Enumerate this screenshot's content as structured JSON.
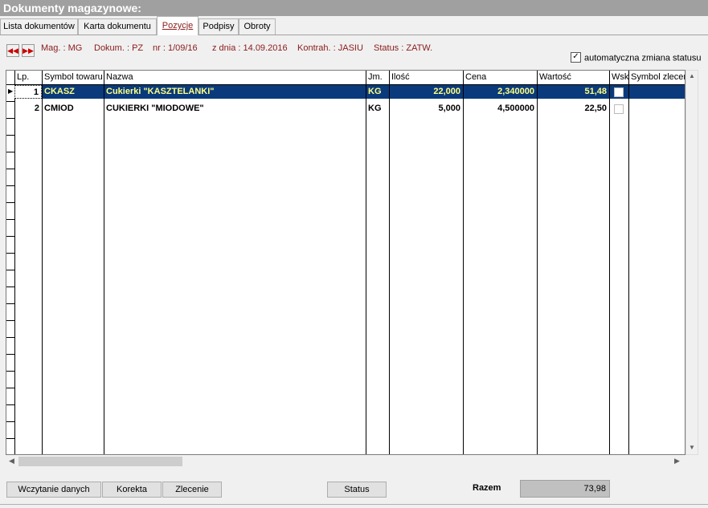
{
  "window": {
    "title": "Dokumenty magazynowe:"
  },
  "tabs": [
    {
      "label": "Lista dokumentów",
      "active": false
    },
    {
      "label": "Karta dokumentu",
      "active": false
    },
    {
      "label": "Pozycje",
      "active": true
    },
    {
      "label": "Podpisy",
      "active": false
    },
    {
      "label": "Obroty",
      "active": false
    }
  ],
  "info": {
    "mag": "Mag. : MG",
    "dokum": "Dokum. : PZ",
    "nr": "nr : 1/09/16",
    "date": "z dnia : 14.09.2016",
    "kontrah": "Kontrah. : JASIU",
    "status": "Status : ZATW."
  },
  "auto_status": {
    "label": "automatyczna zmiana statusu",
    "checked": true
  },
  "grid": {
    "headers": [
      "Lp.",
      "Symbol towaru",
      "Nazwa",
      "Jm.",
      "Ilość",
      "Cena",
      "Wartość",
      "Wsk.",
      "Symbol zlecenia"
    ],
    "rows": [
      {
        "lp": "1",
        "symbol": "CKASZ",
        "nazwa": "Cukierki \"KASZTELANKI\"",
        "jm": "KG",
        "ilosc": "22,000",
        "cena": "2,340000",
        "wartosc": "51,48",
        "selected": true
      },
      {
        "lp": "2",
        "symbol": "CMIOD",
        "nazwa": "CUKIERKI \"MIODOWE\"",
        "jm": "KG",
        "ilosc": "5,000",
        "cena": "4,500000",
        "wartosc": "22,50",
        "selected": false
      }
    ]
  },
  "buttons": {
    "wczytanie": "Wczytanie danych",
    "korekta": "Korekta",
    "zlecenie": "Zlecenie",
    "status": "Status"
  },
  "summary": {
    "label": "Razem",
    "value": "73,98"
  },
  "colors": {
    "selection": "#0a3a7c",
    "selection_text": "#ffff80",
    "info_text": "#8b1a1a"
  },
  "icons": {
    "first": "rewind-icon",
    "next": "fast-forward-icon"
  }
}
